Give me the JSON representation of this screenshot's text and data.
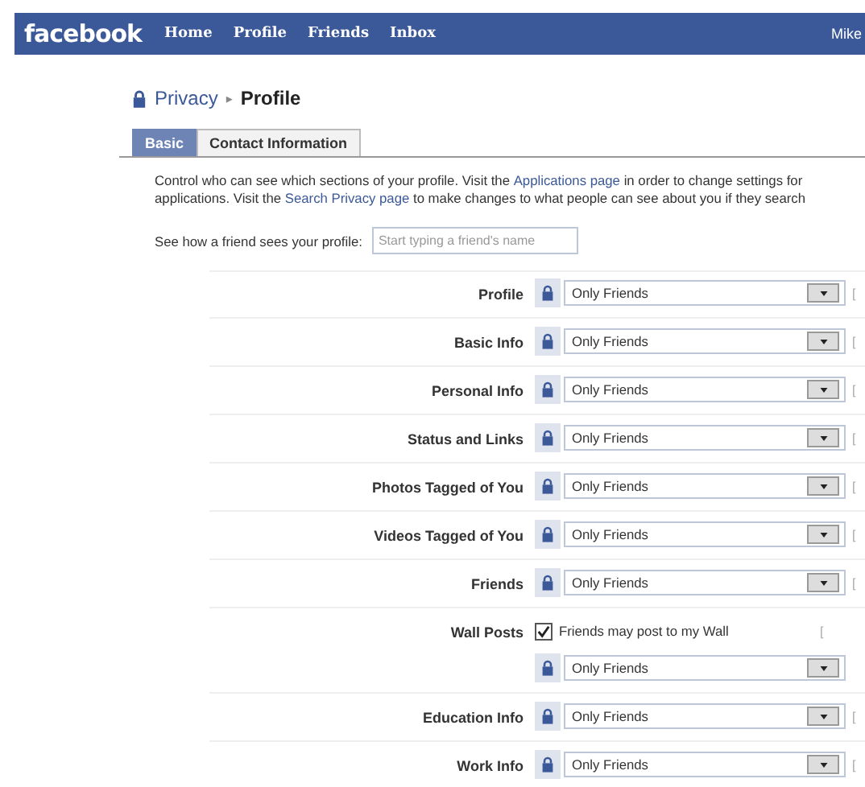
{
  "topbar": {
    "logo": "facebook",
    "nav": [
      "Home",
      "Profile",
      "Friends",
      "Inbox"
    ],
    "user": "Mike"
  },
  "breadcrumb": {
    "parent": "Privacy",
    "separator": "▸",
    "current": "Profile"
  },
  "tabs": [
    {
      "label": "Basic",
      "selected": true
    },
    {
      "label": "Contact Information",
      "selected": false
    }
  ],
  "description": [
    [
      {
        "kind": "text",
        "text": "Control who can see which sections of your profile. Visit the"
      },
      {
        "kind": "link",
        "text": "Applications page"
      },
      {
        "kind": "text",
        "text": "in order to change settings for"
      }
    ],
    [
      {
        "kind": "text",
        "text": "applications. Visit the"
      },
      {
        "kind": "link",
        "text": "Search Privacy page"
      },
      {
        "kind": "text",
        "text": "to make changes to what people can see about you if they search"
      }
    ]
  ],
  "preview": {
    "label": "See how a friend sees your profile:",
    "placeholder": "Start typing a friend's name"
  },
  "rows": [
    {
      "label": "Profile",
      "kind": "select",
      "value": "Only Friends",
      "hint": "["
    },
    {
      "label": "Basic Info",
      "kind": "select",
      "value": "Only Friends",
      "hint": "["
    },
    {
      "label": "Personal Info",
      "kind": "select",
      "value": "Only Friends",
      "hint": "["
    },
    {
      "label": "Status and Links",
      "kind": "select",
      "value": "Only Friends",
      "hint": "["
    },
    {
      "label": "Photos Tagged of You",
      "kind": "select",
      "value": "Only Friends",
      "hint": "["
    },
    {
      "label": "Videos Tagged of You",
      "kind": "select",
      "value": "Only Friends",
      "hint": "["
    },
    {
      "label": "Friends",
      "kind": "select",
      "value": "Only Friends",
      "hint": "["
    },
    {
      "label": "Wall Posts",
      "kind": "checkbox_select",
      "checkbox": {
        "label": "Friends may post to my Wall",
        "checked": true
      },
      "value": "Only Friends",
      "hint": "["
    },
    {
      "label": "Education Info",
      "kind": "select",
      "value": "Only Friends",
      "hint": "["
    },
    {
      "label": "Work Info",
      "kind": "select",
      "value": "Only Friends",
      "hint": "["
    }
  ]
}
